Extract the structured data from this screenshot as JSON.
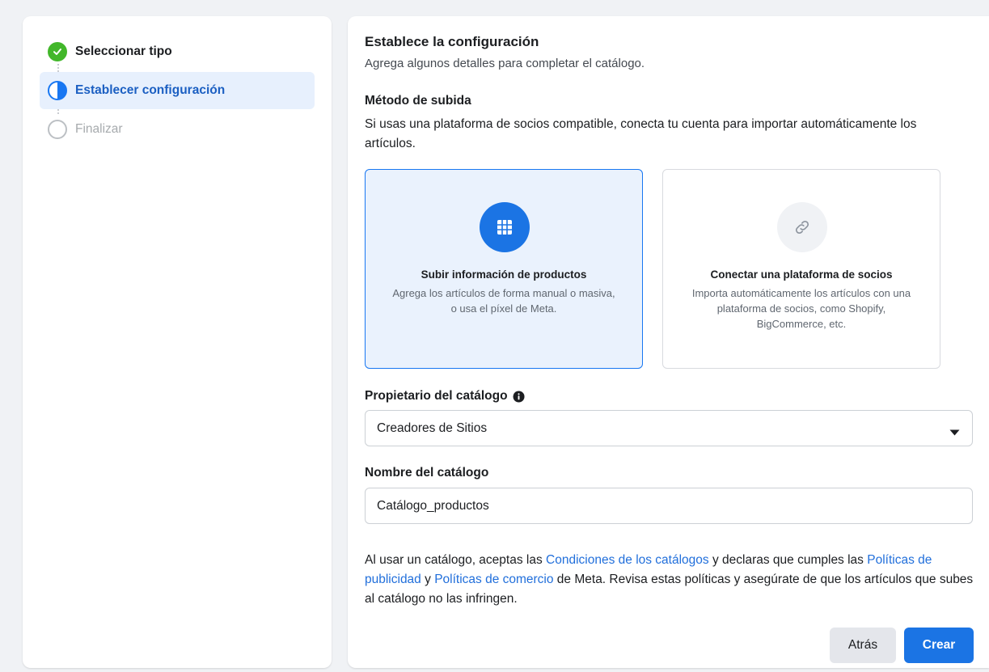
{
  "steps": [
    {
      "label": "Seleccionar tipo",
      "state": "done",
      "icon": "check-icon"
    },
    {
      "label": "Establecer configuración",
      "state": "active",
      "icon": "half-circle-icon"
    },
    {
      "label": "Finalizar",
      "state": "pending",
      "icon": "empty-circle-icon"
    }
  ],
  "main": {
    "title": "Establece la configuración",
    "subtitle": "Agrega algunos detalles para completar el catálogo.",
    "method": {
      "title": "Método de subida",
      "description": "Si usas una plataforma de socios compatible, conecta tu cuenta para importar automáticamente los artículos."
    },
    "cards": [
      {
        "icon": "grid-icon",
        "title": "Subir información de productos",
        "description": "Agrega los artículos de forma manual o masiva, o usa el píxel de Meta.",
        "selected": true
      },
      {
        "icon": "link-icon",
        "title": "Conectar una plataforma de socios",
        "description": "Importa automáticamente los artículos con una plataforma de socios, como Shopify, BigCommerce, etc.",
        "selected": false
      }
    ],
    "owner": {
      "label": "Propietario del catálogo",
      "selected": "Creadores de Sitios"
    },
    "name": {
      "label": "Nombre del catálogo",
      "value": "Catálogo_productos"
    },
    "terms": {
      "t1": "Al usar un catálogo, aceptas las ",
      "link1": "Condiciones de los catálogos",
      "t2": " y declaras que cumples las ",
      "link2": "Políticas de publicidad",
      "t3": " y ",
      "link3": "Políticas de comercio",
      "t4": " de Meta. Revisa estas políticas y asegúrate de que los artículos que subes al catálogo no las infringen."
    },
    "buttons": {
      "back": "Atrás",
      "create": "Crear"
    }
  },
  "colors": {
    "accent": "#1877f2",
    "success": "#42b72a",
    "link": "#216fdb"
  }
}
